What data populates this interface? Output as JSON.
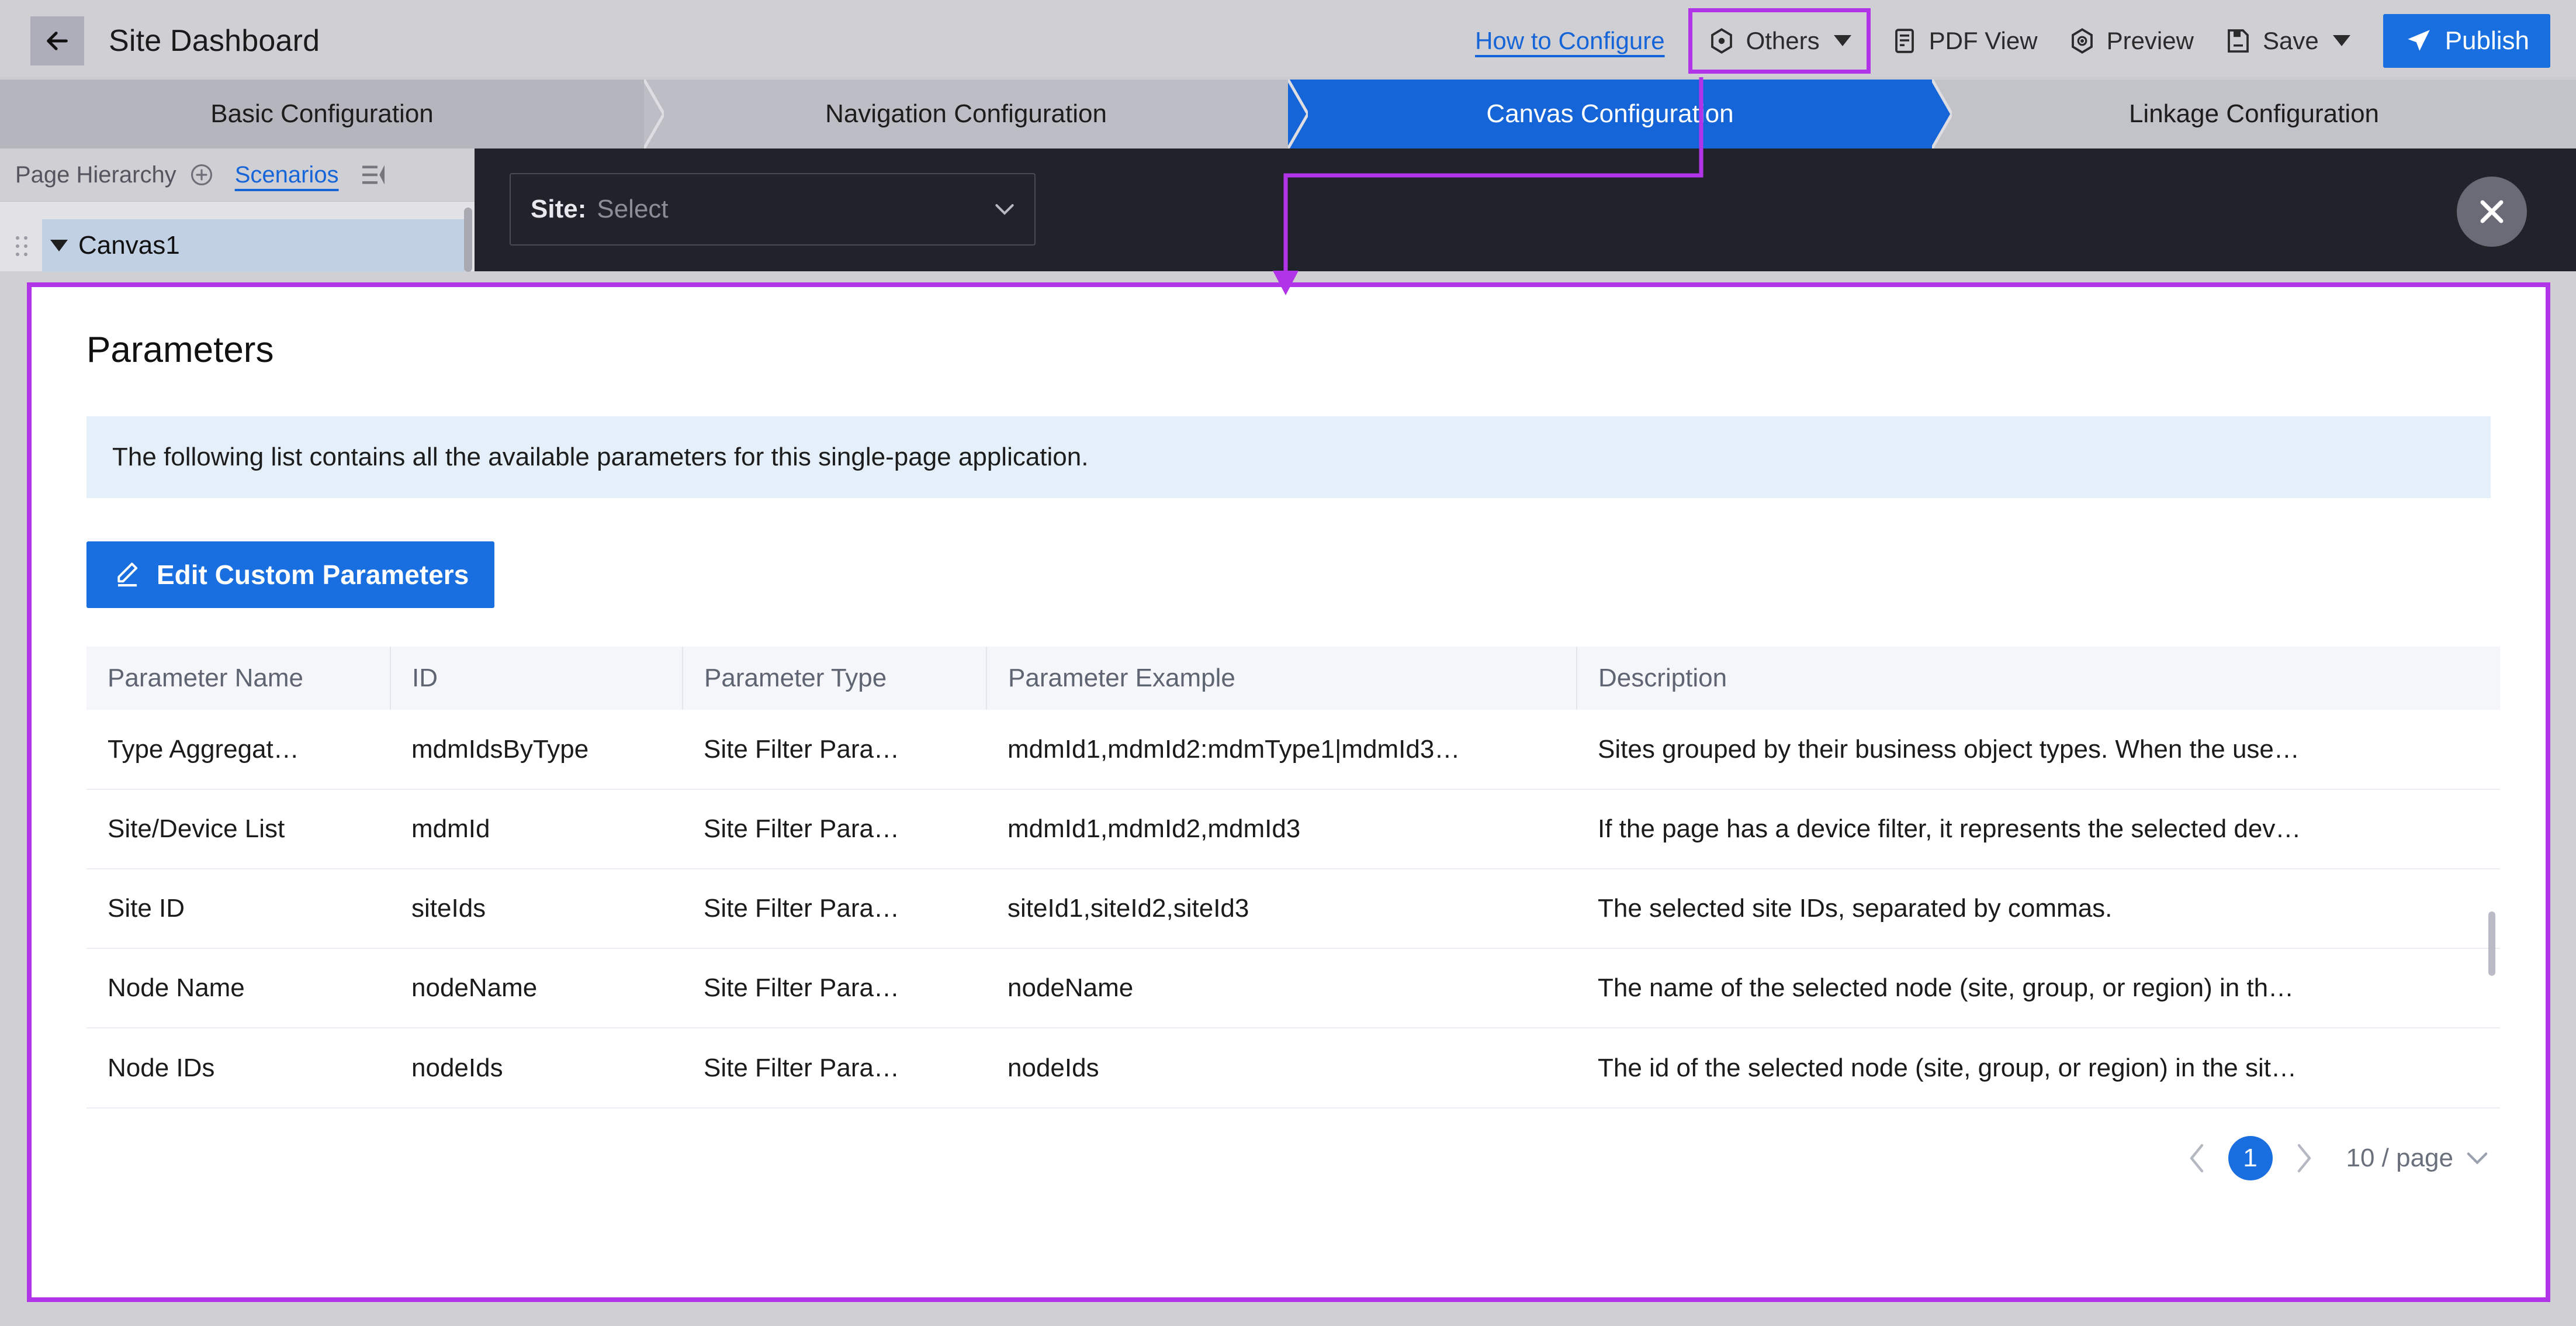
{
  "topbar": {
    "back_icon": "back-arrow-icon",
    "title": "Site Dashboard",
    "how_to_configure": "How to Configure",
    "others": "Others",
    "others_icon": "hexagon-dot-icon",
    "pdf_view": "PDF View",
    "pdf_icon": "document-list-icon",
    "preview": "Preview",
    "preview_icon": "eye-hexagon-icon",
    "save": "Save",
    "save_icon": "floppy-disk-icon",
    "publish": "Publish",
    "publish_icon": "paper-plane-icon"
  },
  "steps": [
    {
      "label": "Basic Configuration",
      "active": false
    },
    {
      "label": "Navigation Configuration",
      "active": false
    },
    {
      "label": "Canvas Configuration",
      "active": true
    },
    {
      "label": "Linkage Configuration",
      "active": false
    }
  ],
  "hierarchy": {
    "title": "Page Hierarchy",
    "add_icon": "plus-circle-icon",
    "scenarios": "Scenarios",
    "collapse_icon": "collapse-panel-icon",
    "node": "Canvas1",
    "drag_icon": "drag-handle-icon",
    "expander_icon": "triangle-down-icon"
  },
  "canvas_toolbar": {
    "site_label": "Site:",
    "site_value": "Select",
    "site_chevron_icon": "chevron-down-icon",
    "close_icon": "close-icon"
  },
  "panel": {
    "title": "Parameters",
    "info": "The following list contains all the available parameters for this single-page application.",
    "edit_button": "Edit Custom Parameters",
    "edit_icon": "pencil-icon",
    "accent_color": "#b234e8",
    "primary_color": "#1a6fe0",
    "columns": [
      "Parameter Name",
      "ID",
      "Parameter Type",
      "Parameter Example",
      "Description"
    ],
    "rows": [
      {
        "name": "Type Aggregat…",
        "id": "mdmIdsByType",
        "type": "Site Filter Para…",
        "example": "mdmId1,mdmId2:mdmType1|mdmId3…",
        "description": "Sites grouped by their business object types. When the use…"
      },
      {
        "name": "Site/Device List",
        "id": "mdmId",
        "type": "Site Filter Para…",
        "example": "mdmId1,mdmId2,mdmId3",
        "description": "If the page has a device filter, it represents the selected dev…"
      },
      {
        "name": "Site ID",
        "id": "siteIds",
        "type": "Site Filter Para…",
        "example": "siteId1,siteId2,siteId3",
        "description": "The selected site IDs, separated by commas."
      },
      {
        "name": "Node Name",
        "id": "nodeName",
        "type": "Site Filter Para…",
        "example": "nodeName",
        "description": "The name of the selected node (site, group, or region) in th…"
      },
      {
        "name": "Node IDs",
        "id": "nodeIds",
        "type": "Site Filter Para…",
        "example": "nodeIds",
        "description": "The id of the selected node (site, group, or region) in the sit…"
      }
    ],
    "pagination": {
      "prev_icon": "chevron-left-icon",
      "next_icon": "chevron-right-icon",
      "current_page": "1",
      "page_size": "10 / page",
      "page_size_icon": "chevron-down-icon"
    }
  }
}
